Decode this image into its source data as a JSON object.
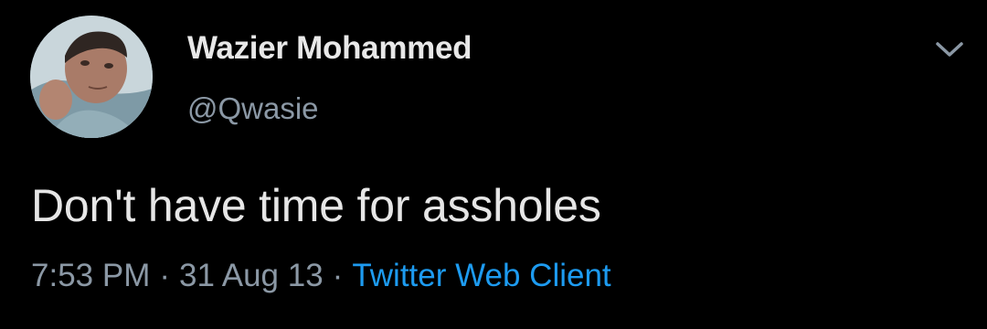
{
  "tweet": {
    "author": {
      "name": "Wazier Mohammed",
      "handle": "@Qwasie"
    },
    "text": "Don't have time for assholes",
    "meta": {
      "time": "7:53 PM",
      "separator": "·",
      "date": "31 Aug 13",
      "client": "Twitter Web Client"
    }
  },
  "icons": {
    "menu": "chevron-down-icon",
    "avatar": "profile-photo"
  },
  "colors": {
    "background": "#000000",
    "text_primary": "#e6e6e6",
    "text_secondary": "#8b98a5",
    "link": "#1d9bf0"
  }
}
